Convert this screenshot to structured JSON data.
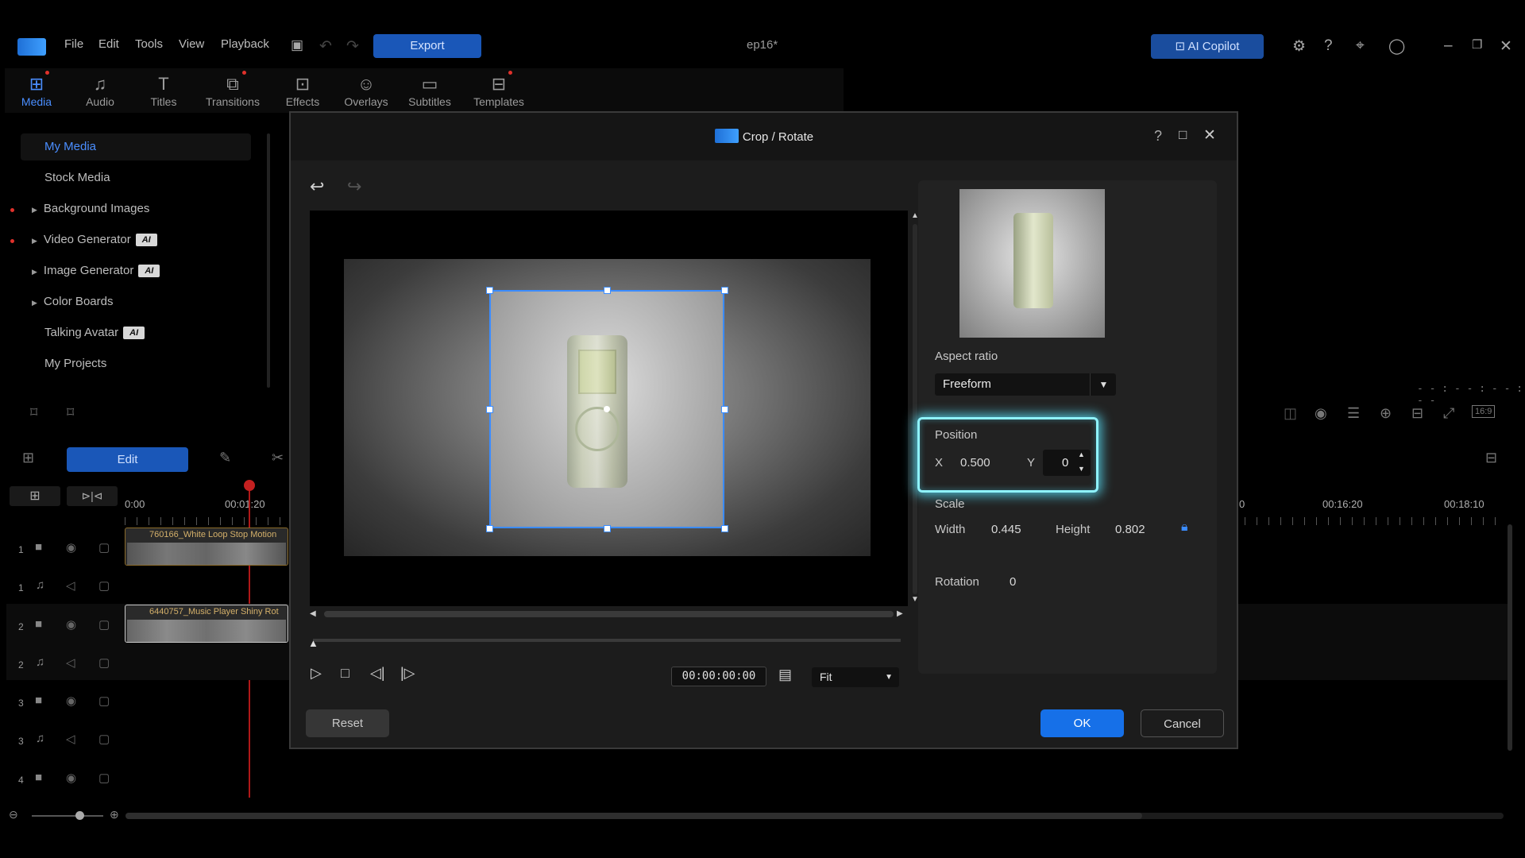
{
  "app": {
    "menu": [
      "File",
      "Edit",
      "Tools",
      "View",
      "Playback"
    ],
    "export_label": "Export",
    "doc_title": "ep16*",
    "copilot_label": "AI Copilot"
  },
  "tabs": [
    {
      "label": "Media",
      "icon": "media-icon"
    },
    {
      "label": "Audio",
      "icon": "audio-icon"
    },
    {
      "label": "Titles",
      "icon": "titles-icon"
    },
    {
      "label": "Transitions",
      "icon": "transitions-icon"
    },
    {
      "label": "Effects",
      "icon": "effects-icon"
    },
    {
      "label": "Overlays",
      "icon": "overlays-icon"
    },
    {
      "label": "Subtitles",
      "icon": "subtitles-icon"
    },
    {
      "label": "Templates",
      "icon": "templates-icon"
    }
  ],
  "sidebar": {
    "items": [
      {
        "label": "My Media"
      },
      {
        "label": "Stock Media"
      },
      {
        "label": "Background Images"
      },
      {
        "label": "Video Generator",
        "badge": "AI"
      },
      {
        "label": "Image Generator",
        "badge": "AI"
      },
      {
        "label": "Color Boards"
      },
      {
        "label": "Talking Avatar",
        "badge": "AI"
      },
      {
        "label": "My Projects"
      }
    ]
  },
  "timeline": {
    "edit_label": "Edit",
    "ruler": [
      "0:00",
      "00:01:20",
      "00:16:20",
      "00:18:10"
    ],
    "right_zero": "0",
    "timecode_placeholder": "- - : - - : - - : - -",
    "aspect_badge": "16:9",
    "tracks": [
      {
        "num": "1",
        "type": "video"
      },
      {
        "num": "1",
        "type": "audio"
      },
      {
        "num": "2",
        "type": "video"
      },
      {
        "num": "2",
        "type": "audio"
      },
      {
        "num": "3",
        "type": "video"
      },
      {
        "num": "3",
        "type": "audio"
      },
      {
        "num": "4",
        "type": "video"
      }
    ],
    "clips": [
      {
        "title": "760166_White Loop Stop Motion"
      },
      {
        "title": "6440757_Music Player Shiny Rot"
      }
    ]
  },
  "dialog": {
    "title": "Crop / Rotate",
    "timecode": "00:00:00:00",
    "fit_label": "Fit",
    "aspect_ratio_label": "Aspect ratio",
    "aspect_ratio_value": "Freeform",
    "position_label": "Position",
    "x_label": "X",
    "x_value": "0.500",
    "y_label": "Y",
    "y_value": "0",
    "scale_label": "Scale",
    "width_label": "Width",
    "width_value": "0.445",
    "height_label": "Height",
    "height_value": "0.802",
    "rotation_label": "Rotation",
    "rotation_value": "0",
    "reset_label": "Reset",
    "ok_label": "OK",
    "cancel_label": "Cancel"
  },
  "colors": {
    "accent": "#1670e8",
    "highlight": "#8ff3ff",
    "crop_border": "#3b8cff"
  }
}
